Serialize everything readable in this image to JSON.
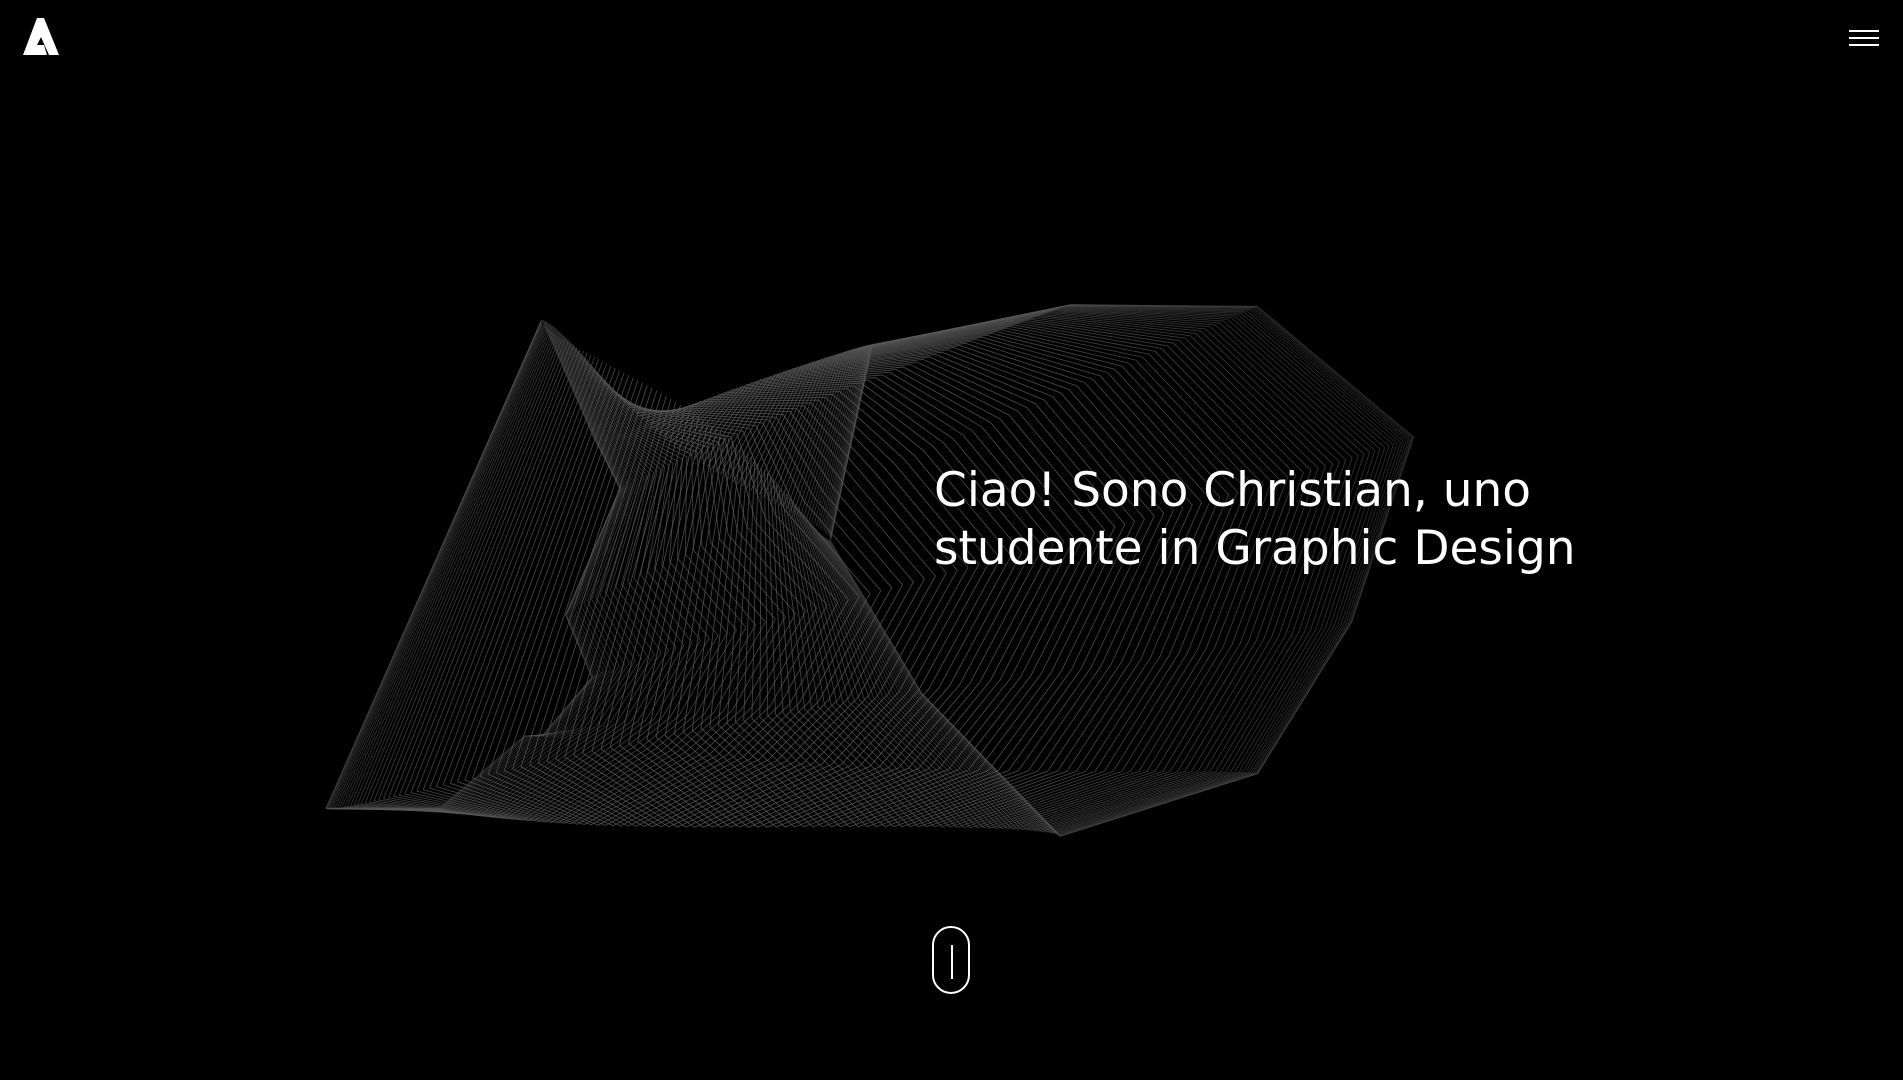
{
  "header": {
    "logo_icon": "letter-a-logo-icon",
    "menu_icon": "hamburger-menu-icon"
  },
  "hero": {
    "headline_line1": "Ciao! Sono Christian, uno",
    "headline_line2_prefix": "studente in ",
    "headline_highlight": "Graphic Design",
    "art_icon": "wireframe-a-logo-illustration"
  },
  "scroll": {
    "icon": "mouse-scroll-icon"
  },
  "colors": {
    "background": "#000000",
    "text": "#ffffff",
    "accent": "#f7923a",
    "wireframe": "#5a5a5a"
  }
}
